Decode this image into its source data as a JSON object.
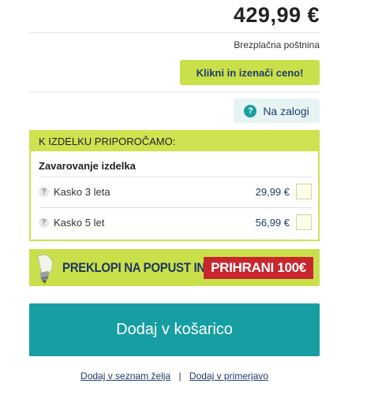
{
  "price": "429,99 €",
  "shipping": "Brezplačna poštnina",
  "compare_button": "Klikni in izenači ceno!",
  "stock": {
    "icon": "question-icon",
    "label": "Na zalogi"
  },
  "recommend": {
    "header": "K IZDELKU PRIPOROČAMO:",
    "title": "Zavarovanje izdelka",
    "items": [
      {
        "label": "Kasko 3 leta",
        "price": "29,99 €",
        "checked": false
      },
      {
        "label": "Kasko 5 let",
        "price": "56,99 €",
        "checked": false
      }
    ]
  },
  "promo": {
    "text": "PREKLOPI NA POPUST IN",
    "badge": "PRIHRANI 100€",
    "icon": "lightbulb-icon"
  },
  "cart_button": "Dodaj v košarico",
  "links": {
    "wishlist": "Dodaj v seznam želja",
    "separator": "|",
    "compare": "Dodaj v primerjavo"
  },
  "colors": {
    "accent_green": "#c9e04a",
    "teal": "#169ea3",
    "navy": "#223a6b",
    "red": "#c8272f"
  }
}
